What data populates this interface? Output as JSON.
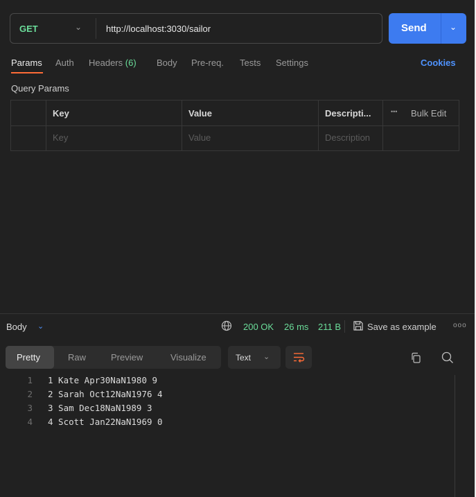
{
  "request": {
    "method": "GET",
    "url": "http://localhost:3030/sailor",
    "send_label": "Send"
  },
  "tabs": [
    {
      "label": "Params",
      "count": ""
    },
    {
      "label": "Auth",
      "count": ""
    },
    {
      "label": "Headers",
      "count": "(6)"
    },
    {
      "label": "Body",
      "count": ""
    },
    {
      "label": "Pre-req.",
      "count": ""
    },
    {
      "label": "Tests",
      "count": ""
    },
    {
      "label": "Settings",
      "count": ""
    }
  ],
  "cookies_label": "Cookies",
  "query_params": {
    "title": "Query Params",
    "headers": {
      "key": "Key",
      "value": "Value",
      "description": "Descripti...",
      "bulk": "Bulk Edit",
      "more": "•••"
    },
    "placeholders": {
      "key": "Key",
      "value": "Value",
      "description": "Description"
    }
  },
  "response": {
    "label": "Body",
    "status": "200 OK",
    "time": "26 ms",
    "size": "211 B",
    "save_label": "Save as example",
    "more": "ooo",
    "view_tabs": [
      "Pretty",
      "Raw",
      "Preview",
      "Visualize"
    ],
    "format": "Text",
    "lines": [
      {
        "num": "1",
        "text": "1 Kate Apr30NaN1980 9"
      },
      {
        "num": "2",
        "text": "2 Sarah Oct12NaN1976 4"
      },
      {
        "num": "3",
        "text": "3 Sam Dec18NaN1989 3"
      },
      {
        "num": "4",
        "text": "4 Scott Jan22NaN1969 0"
      }
    ]
  },
  "colors": {
    "accent": "#3d7bf0",
    "success": "#6bdd9a",
    "tab_active": "#ff6c37",
    "link": "#4f93ff"
  },
  "icons": [
    "chevron-down-icon",
    "globe-icon",
    "save-icon",
    "wrap-lines-icon",
    "copy-icon",
    "search-icon",
    "more-icon"
  ]
}
